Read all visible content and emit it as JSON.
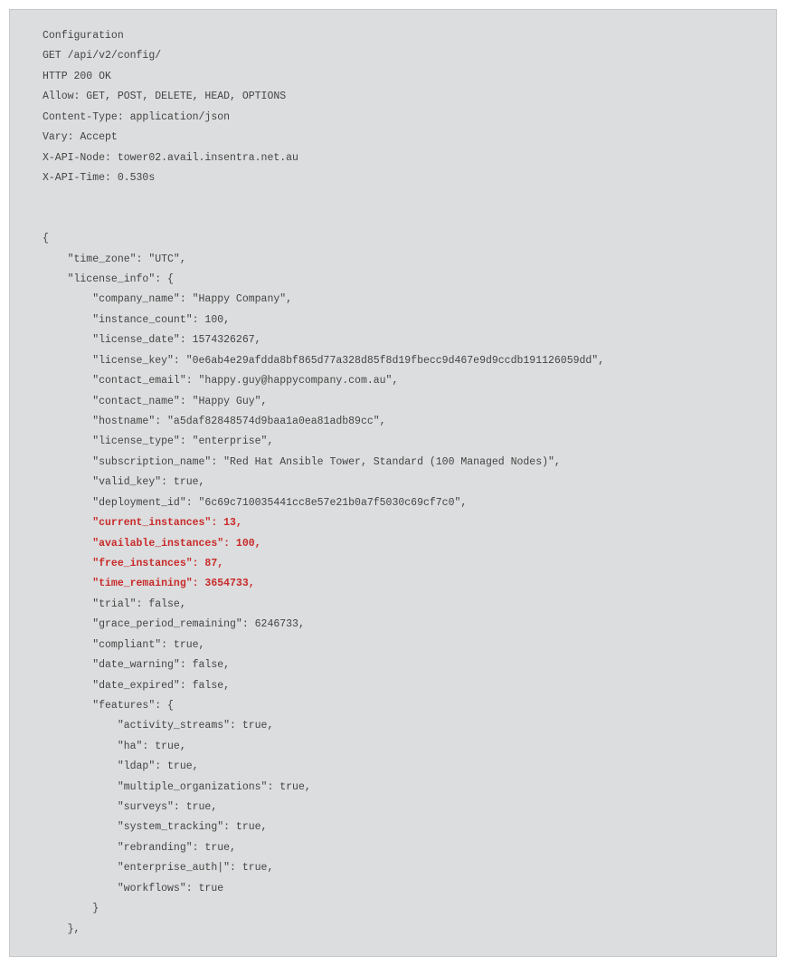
{
  "header": {
    "title": "Configuration",
    "request": "GET /api/v2/config/",
    "status": "HTTP 200 OK",
    "allow": "Allow: GET, POST, DELETE, HEAD, OPTIONS",
    "content_type": "Content-Type: application/json",
    "vary": "Vary: Accept",
    "api_node": "X-API-Node: tower02.avail.insentra.net.au",
    "api_time": "X-API-Time: 0.530s"
  },
  "body": {
    "open_brace": "{",
    "time_zone": "    \"time_zone\": \"UTC\",",
    "license_info_open": "    \"license_info\": {",
    "company_name": "        \"company_name\": \"Happy Company\",",
    "instance_count": "        \"instance_count\": 100,",
    "license_date": "        \"license_date\": 1574326267,",
    "license_key": "        \"license_key\": \"0e6ab4e29afdda8bf865d77a328d85f8d19fbecc9d467e9d9ccdb191126059dd\",",
    "contact_email": "        \"contact_email\": \"happy.guy@happycompany.com.au\",",
    "contact_name": "        \"contact_name\": \"Happy Guy\",",
    "hostname": "        \"hostname\": \"a5daf82848574d9baa1a0ea81adb89cc\",",
    "license_type": "        \"license_type\": \"enterprise\",",
    "subscription_name": "        \"subscription_name\": \"Red Hat Ansible Tower, Standard (100 Managed Nodes)\",",
    "valid_key": "        \"valid_key\": true,",
    "deployment_id": "        \"deployment_id\": \"6c69c710035441cc8e57e21b0a7f5030c69cf7c0\",",
    "current_instances": "        \"current_instances\": 13,",
    "available_instances": "        \"available_instances\": 100,",
    "free_instances": "        \"free_instances\": 87,",
    "time_remaining": "        \"time_remaining\": 3654733,",
    "trial": "        \"trial\": false,",
    "grace_period_remaining": "        \"grace_period_remaining\": 6246733,",
    "compliant": "        \"compliant\": true,",
    "date_warning": "        \"date_warning\": false,",
    "date_expired": "        \"date_expired\": false,",
    "features_open": "        \"features\": {",
    "activity_streams": "            \"activity_streams\": true,",
    "ha": "            \"ha\": true,",
    "ldap": "            \"ldap\": true,",
    "multiple_organizations": "            \"multiple_organizations\": true,",
    "surveys": "            \"surveys\": true,",
    "system_tracking": "            \"system_tracking\": true,",
    "rebranding": "            \"rebranding\": true,",
    "enterprise_auth": "            \"enterprise_auth|\": true,",
    "workflows": "            \"workflows\": true",
    "features_close": "        }",
    "license_info_close": "    },"
  }
}
